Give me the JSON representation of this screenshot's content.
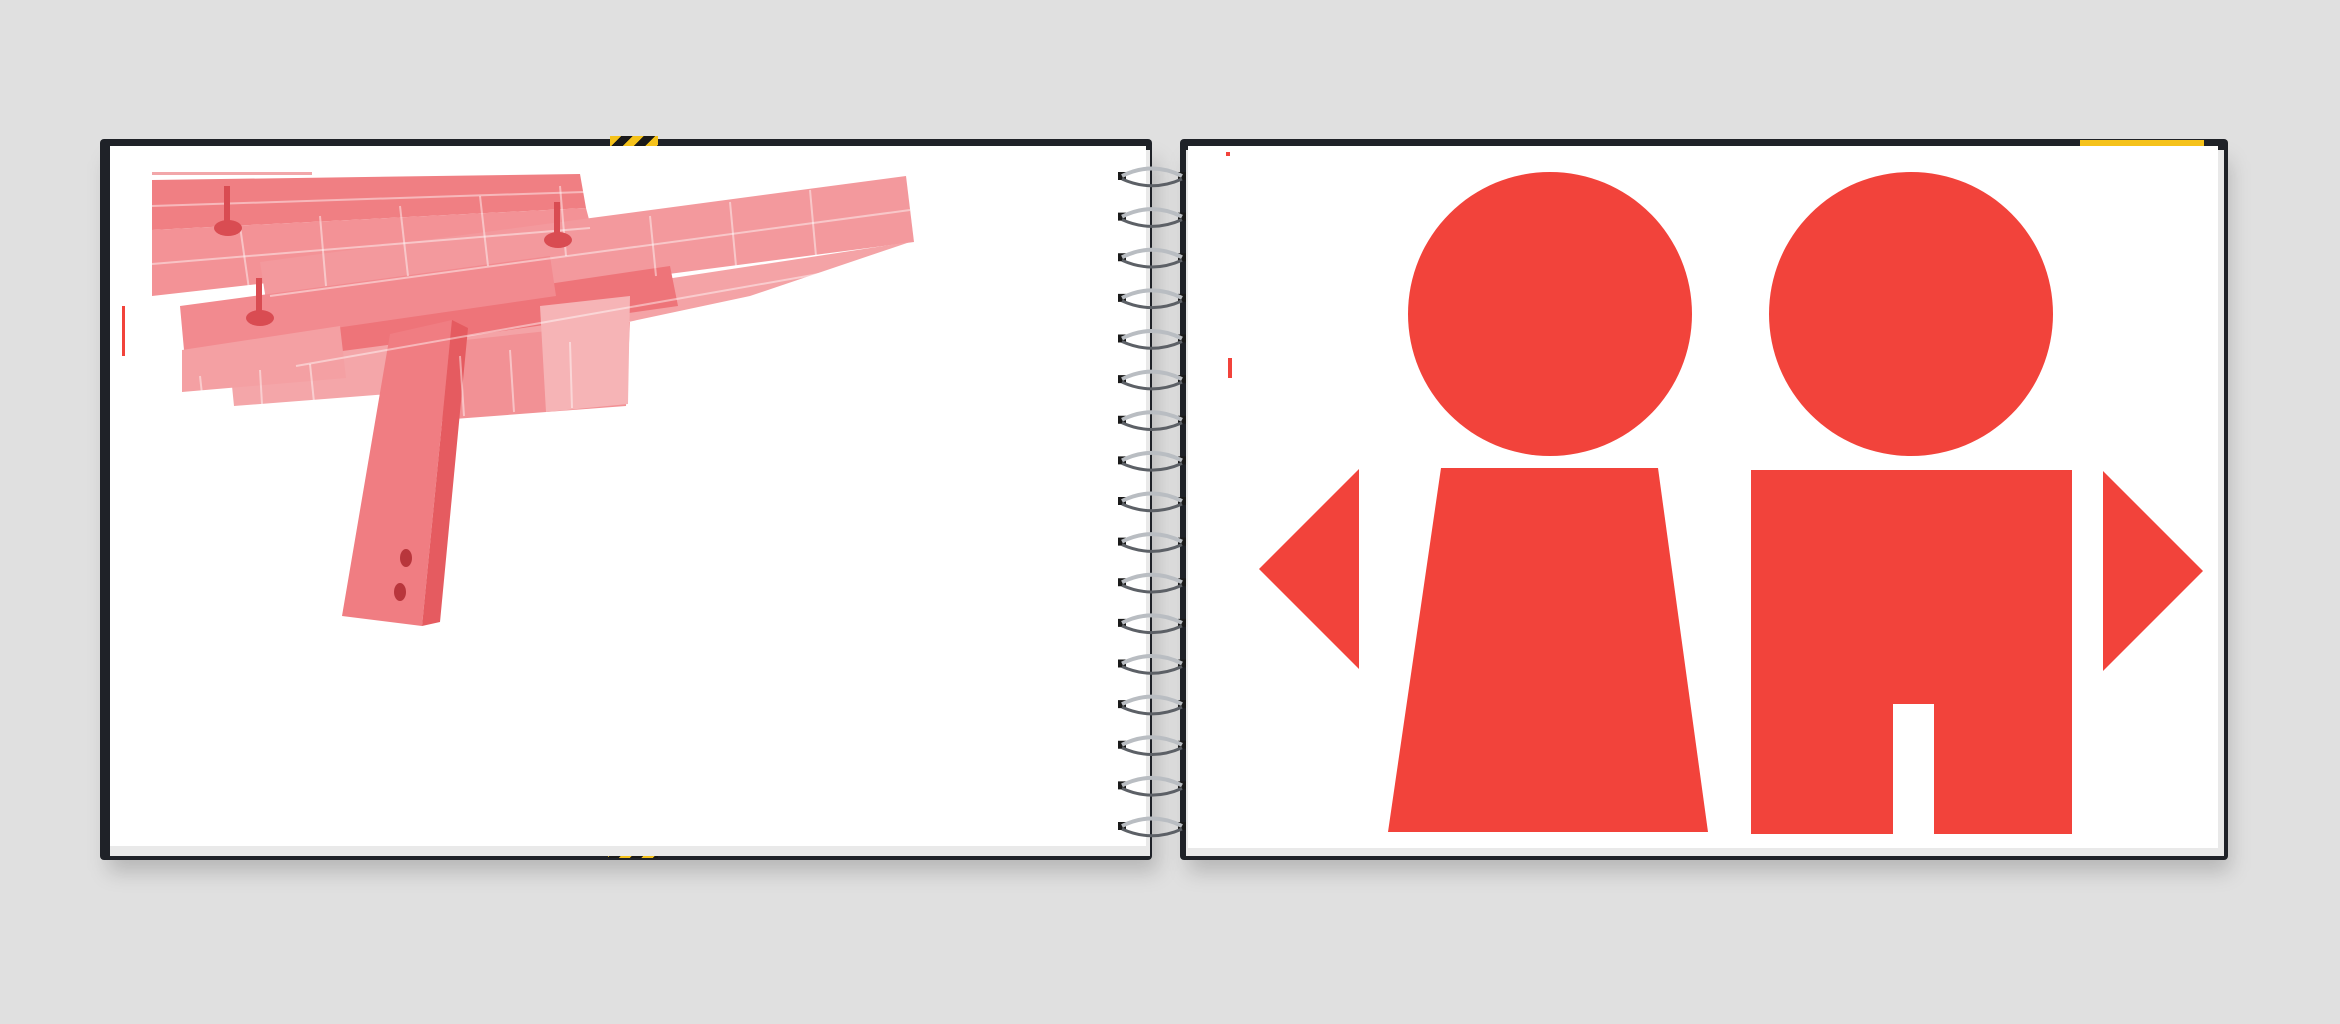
{
  "scene": {
    "description_type": "photograph",
    "object": "open-spiral-bound-book",
    "colors": {
      "background": "#e0e0e0",
      "cover": "#1f2228",
      "page": "#ffffff",
      "page_edge": "#e9e9e9",
      "accent_red": "#f2433b",
      "photo_tint": "#f07f83",
      "photo_tint_dark": "#e55b60",
      "hazard_yellow": "#f5c21b",
      "hazard_black": "#1a1a1a",
      "wire": "#b9bdc2",
      "wire_dark": "#5c6066"
    },
    "spiral": {
      "loop_count": 17
    },
    "left_page": {
      "content": "red-tinted-photograph-of-building-beams"
    },
    "right_page": {
      "content": "pictogram-two-figures-with-direction-arrows",
      "figures": [
        "figure-left-trapezoid-body",
        "figure-right-trouser-body"
      ],
      "arrows": [
        "arrow-pointing-left",
        "arrow-pointing-right"
      ]
    }
  }
}
